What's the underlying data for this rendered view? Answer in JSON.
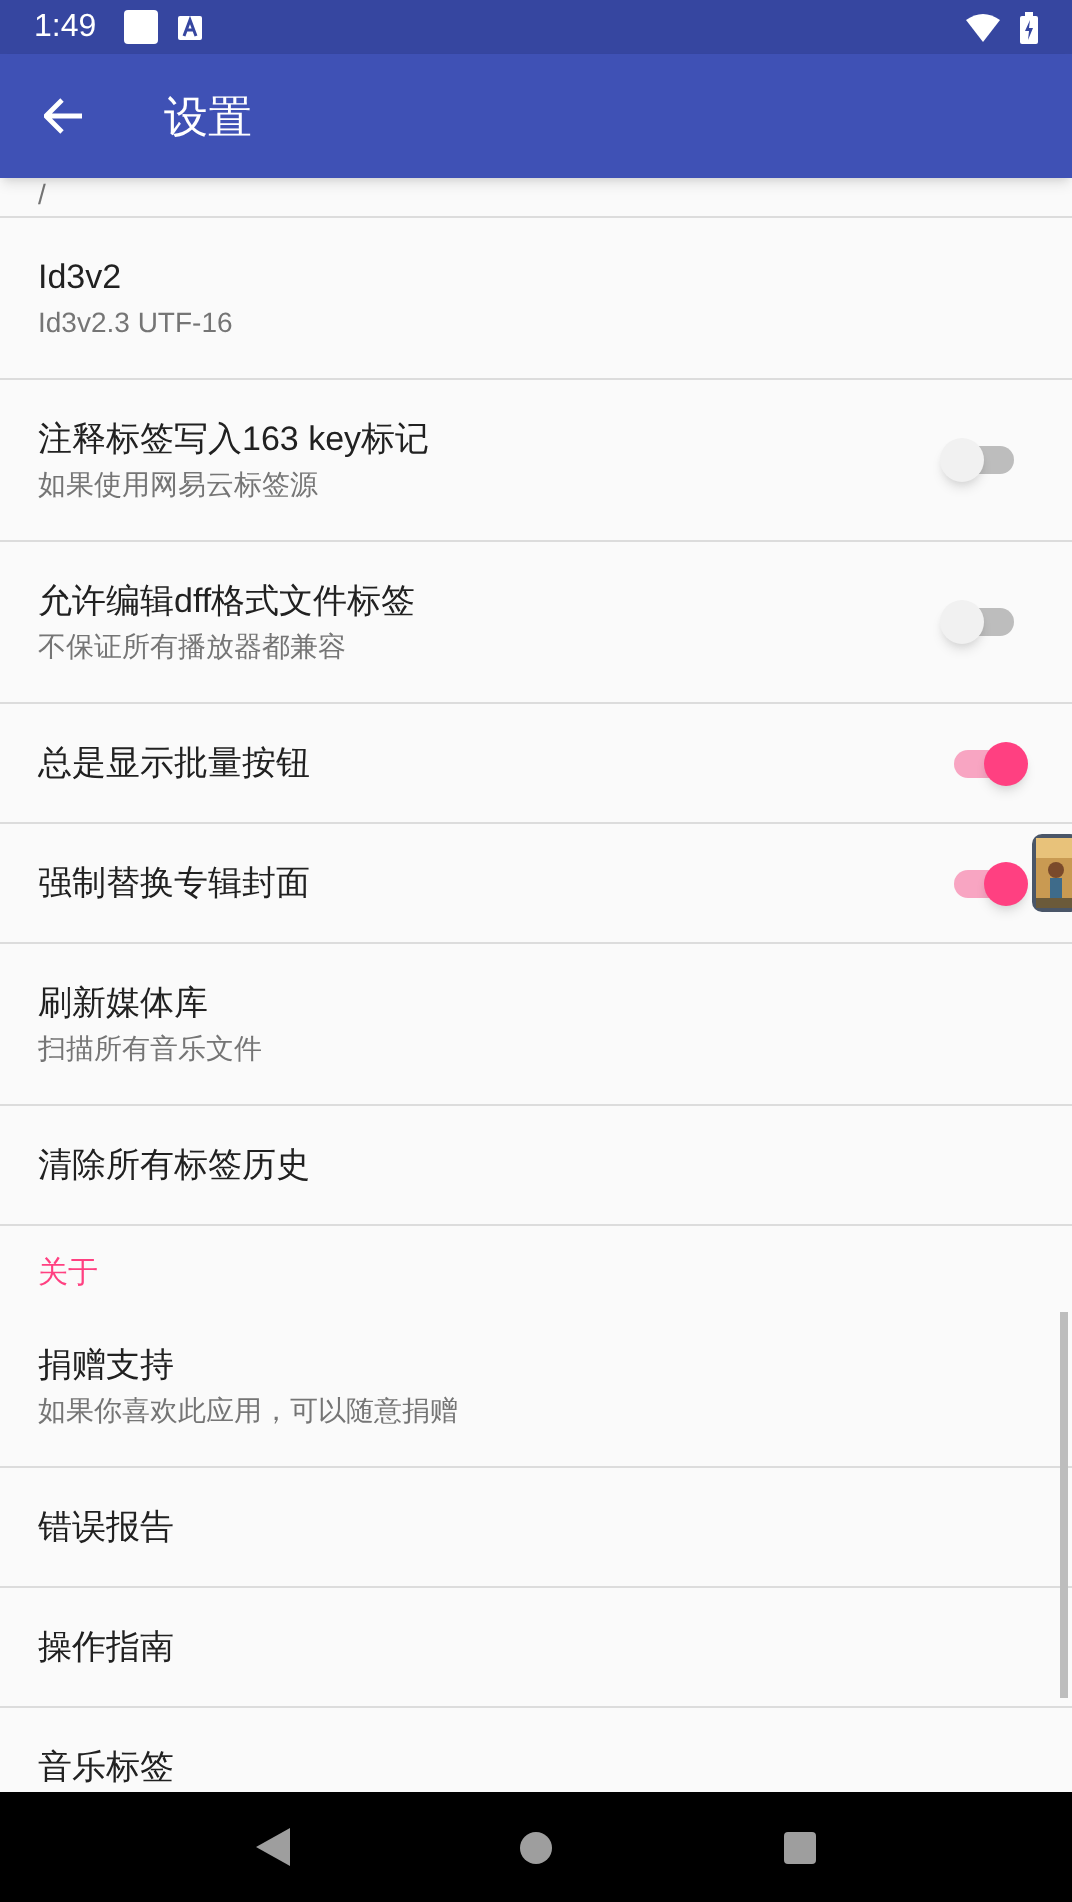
{
  "status_bar": {
    "time": "1:49"
  },
  "app_bar": {
    "title": "设置"
  },
  "items": [
    {
      "kind": "fragment",
      "subtitle": "/"
    },
    {
      "kind": "text",
      "title": "Id3v2",
      "subtitle": "Id3v2.3 UTF-16"
    },
    {
      "kind": "switch",
      "title": "注释标签写入163 key标记",
      "subtitle": "如果使用网易云标签源",
      "on": false
    },
    {
      "kind": "switch",
      "title": "允许编辑dff格式文件标签",
      "subtitle": "不保证所有播放器都兼容",
      "on": false
    },
    {
      "kind": "switch",
      "title": "总是显示批量按钮",
      "on": true
    },
    {
      "kind": "switch",
      "title": "强制替换专辑封面",
      "on": true
    },
    {
      "kind": "text",
      "title": "刷新媒体库",
      "subtitle": "扫描所有音乐文件"
    },
    {
      "kind": "text",
      "title": "清除所有标签历史"
    },
    {
      "kind": "category",
      "title": "关于"
    },
    {
      "kind": "text",
      "title": "捐赠支持",
      "subtitle": "如果你喜欢此应用，可以随意捐赠"
    },
    {
      "kind": "text",
      "title": "错误报告"
    },
    {
      "kind": "text",
      "title": "操作指南"
    },
    {
      "kind": "text",
      "title": "音乐标签"
    }
  ]
}
